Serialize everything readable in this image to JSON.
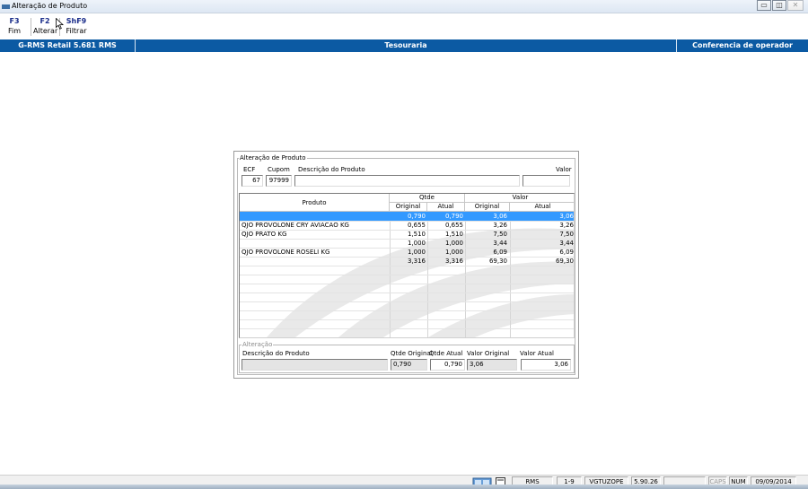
{
  "window": {
    "title": "Alteração de Produto",
    "buttons": {
      "minimize": "▭",
      "restore": "◫",
      "close": "✕"
    }
  },
  "toolbar": {
    "items": [
      {
        "key": "F3",
        "label": "Fim"
      },
      {
        "key": "F2",
        "label": "Alterar"
      },
      {
        "key": "ShF9",
        "label": "Filtrar"
      }
    ]
  },
  "header": {
    "app": "G-RMS Retail 5.681 RMS",
    "module": "Tesouraria",
    "screen": "Conferencia de operador"
  },
  "panel": {
    "title": "Alteração de Produto",
    "top_labels": {
      "ecf": "ECF",
      "cupom": "Cupom",
      "descricao": "Descrição do Produto",
      "valor": "Valor"
    },
    "top_values": {
      "ecf": "67",
      "cupom": "97999",
      "descricao": "",
      "valor": ""
    },
    "grid": {
      "headers": {
        "produto": "Produto",
        "qtde": "Qtde",
        "valor": "Valor",
        "qtde_original": "Original",
        "qtde_atual": "Atual",
        "valor_original": "Original",
        "valor_atual": "Atual"
      },
      "rows": [
        {
          "produto": "",
          "qtde_original": "0,790",
          "qtde_atual": "0,790",
          "valor_original": "3,06",
          "valor_atual": "3,06"
        },
        {
          "produto": "QJO PROVOLONE CRY AVIACAO KG",
          "qtde_original": "0,655",
          "qtde_atual": "0,655",
          "valor_original": "3,26",
          "valor_atual": "3,26"
        },
        {
          "produto": "QJO PRATO KG",
          "qtde_original": "1,510",
          "qtde_atual": "1,510",
          "valor_original": "7,50",
          "valor_atual": "7,50"
        },
        {
          "produto": "",
          "qtde_original": "1,000",
          "qtde_atual": "1,000",
          "valor_original": "3,44",
          "valor_atual": "3,44"
        },
        {
          "produto": "QJO PROVOLONE ROSELI KG",
          "qtde_original": "1,000",
          "qtde_atual": "1,000",
          "valor_original": "6,09",
          "valor_atual": "6,09"
        },
        {
          "produto": "",
          "qtde_original": "3,316",
          "qtde_atual": "3,316",
          "valor_original": "69,30",
          "valor_atual": "69,30"
        }
      ]
    },
    "alteracao": {
      "title": "Alteração",
      "labels": {
        "descricao": "Descrição do Produto",
        "qtde_original": "Qtde Original",
        "qtde_atual": "Qtde Atual",
        "valor_original": "Valor Original",
        "valor_atual": "Valor Atual"
      },
      "values": {
        "descricao": "",
        "qtde_original": "0,790",
        "qtde_atual": "0,790",
        "valor_original": "3,06",
        "valor_atual": "3,06"
      }
    }
  },
  "statusbar": {
    "cells": [
      "RMS",
      "1-9",
      "VGTUZOPE",
      "5.90.26",
      "",
      "CAPS",
      "NUM",
      "09/09/2014"
    ]
  }
}
